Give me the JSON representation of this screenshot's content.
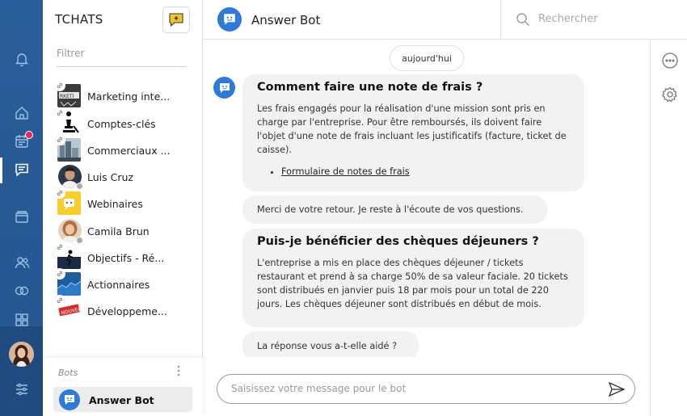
{
  "sidebar_rail": {
    "icons": [
      "bell-icon",
      "home-icon",
      "calendar-icon",
      "chat-icon",
      "folder-icon",
      "people-icon",
      "toggle-icon",
      "grid-icon",
      "sliders-icon"
    ],
    "active": "chat-icon",
    "notification_color": "#e8245a",
    "background": "#2a5e9a"
  },
  "chat_panel": {
    "title": "TCHATS",
    "new_chat_icon": "new-chat-icon",
    "filter_placeholder": "Filtrer",
    "chats": [
      {
        "name": "Marketing inte...",
        "kind": "group",
        "thumb": "marketing"
      },
      {
        "name": "Comptes-clés",
        "kind": "group",
        "thumb": "chess"
      },
      {
        "name": "Commerciaux ...",
        "kind": "group",
        "thumb": "city"
      },
      {
        "name": "Luis Cruz",
        "kind": "person",
        "status": "offline",
        "thumb": "man"
      },
      {
        "name": "Webinaires",
        "kind": "group",
        "thumb": "yellow"
      },
      {
        "name": "Camila Brun",
        "kind": "person",
        "status": "offline",
        "thumb": "woman"
      },
      {
        "name": "Objectifs - Ré...",
        "kind": "group",
        "thumb": "runner"
      },
      {
        "name": "Actionnaires",
        "kind": "group",
        "thumb": "blue"
      },
      {
        "name": "Développeme...",
        "kind": "group",
        "thumb": "nouveau"
      }
    ],
    "bots_label": "Bots",
    "bot": {
      "name": "Answer Bot"
    }
  },
  "header": {
    "title": "Answer Bot",
    "search_placeholder": "Rechercher"
  },
  "conversation": {
    "date_chip": "aujourd'hui",
    "messages": [
      {
        "title": "Comment faire une note de frais ?",
        "body": "Les frais engagés pour la réalisation d'une mission sont pris en charge par l'entreprise. Pour être remboursés, ils doivent faire l'objet d'une note de frais incluant les justificatifs (facture, ticket de caisse).",
        "link": "Formulaire de notes de frais"
      },
      {
        "text": "Merci de votre retour. Je reste à l'écoute de vos questions."
      },
      {
        "title": "Puis-je bénéficier des chèques déjeuners ?",
        "body": "L'entreprise a mis en place des chèques déjeuner / tickets restaurant et prend à sa charge 50% de sa valeur faciale. 20 tickets sont distribués en janvier puis 18 par mois pour un total de 220 jours. Les chèques déjeuner sont distribués en début de mois."
      },
      {
        "text": "La réponse vous a-t-elle aidé ?"
      }
    ]
  },
  "composer": {
    "placeholder": "Saisissez votre message pour le bot"
  },
  "tools": [
    "more-icon",
    "settings-icon"
  ],
  "colors": {
    "accent": "#2f79d9",
    "new_chat": "#f4c430",
    "bubble": "#f2f2f2"
  }
}
